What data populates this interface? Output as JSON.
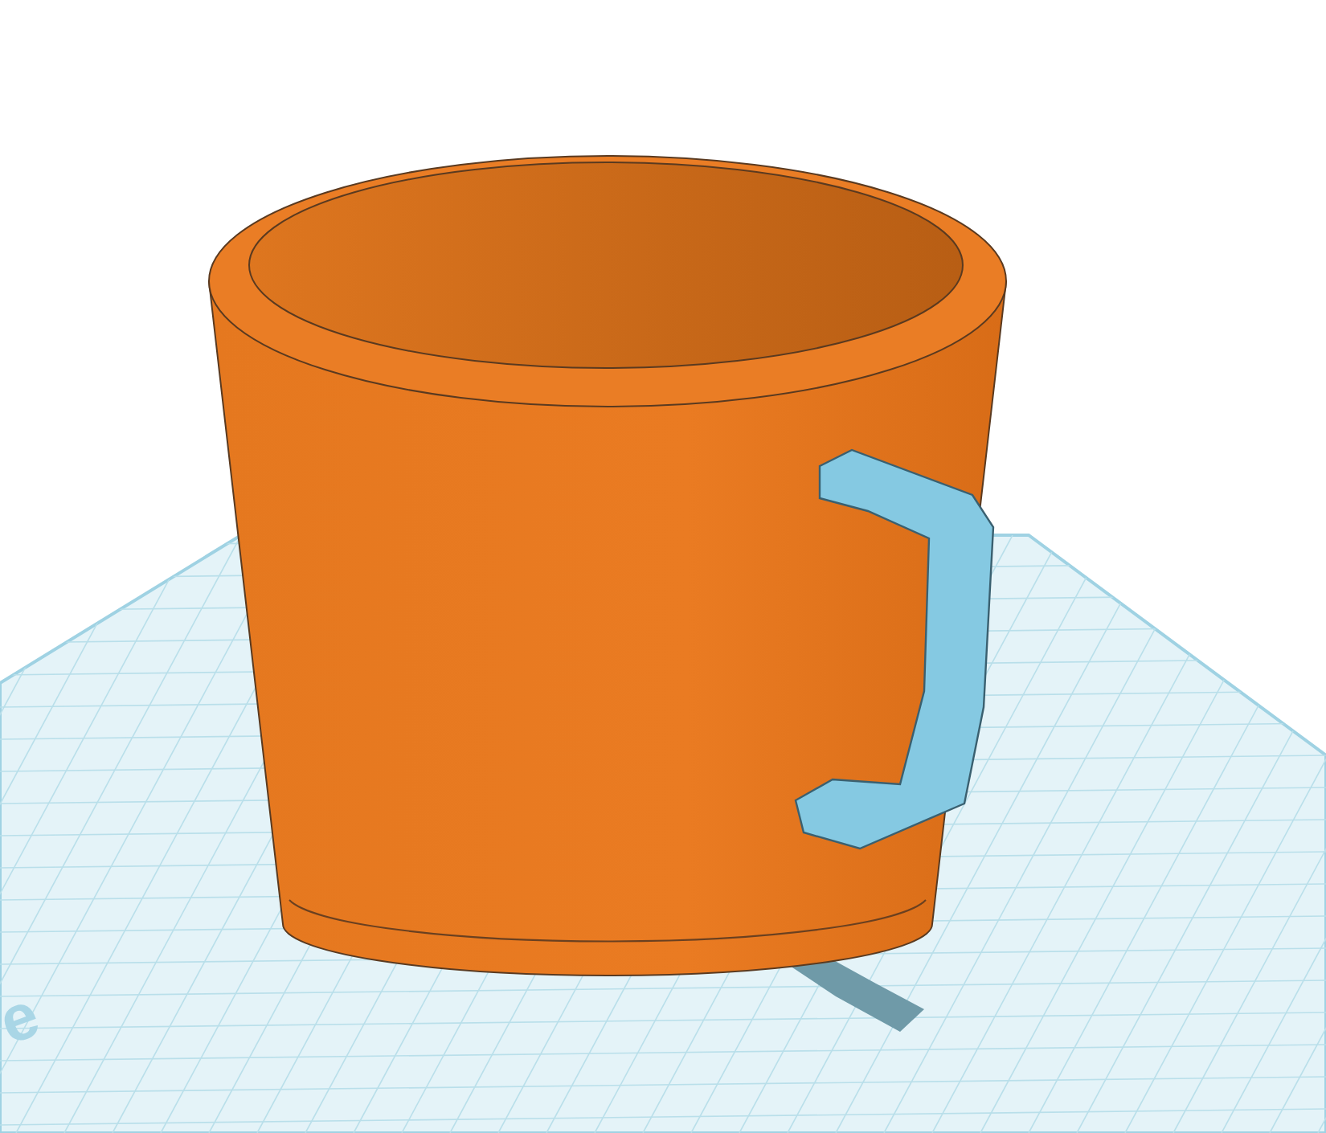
{
  "viewport": {
    "workplane_label": "e"
  }
}
